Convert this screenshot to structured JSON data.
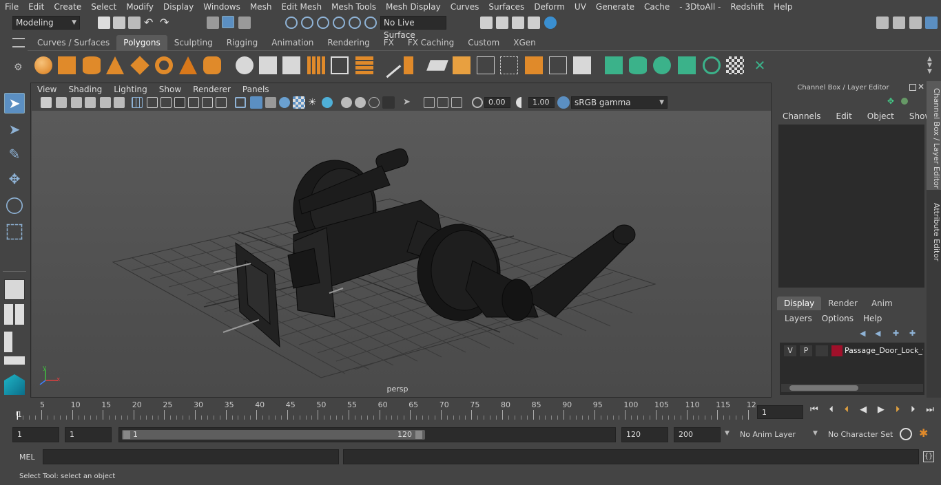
{
  "menubar": [
    "File",
    "Edit",
    "Create",
    "Select",
    "Modify",
    "Display",
    "Windows",
    "Mesh",
    "Edit Mesh",
    "Mesh Tools",
    "Mesh Display",
    "Curves",
    "Surfaces",
    "Deform",
    "UV",
    "Generate",
    "Cache",
    "- 3DtoAll -",
    "Redshift",
    "Help"
  ],
  "statusline": {
    "mode": "Modeling",
    "live_surface": "No Live Surface"
  },
  "shelf_tabs": [
    "Curves / Surfaces",
    "Polygons",
    "Sculpting",
    "Rigging",
    "Animation",
    "Rendering",
    "FX",
    "FX Caching",
    "Custom",
    "XGen"
  ],
  "shelf_active": "Polygons",
  "viewport": {
    "menu": [
      "View",
      "Shading",
      "Lighting",
      "Show",
      "Renderer",
      "Panels"
    ],
    "exposure": "0.00",
    "gamma": "1.00",
    "color_space": "sRGB gamma",
    "camera_label": "persp"
  },
  "channel_box": {
    "title": "Channel Box / Layer Editor",
    "menu": [
      "Channels",
      "Edit",
      "Object",
      "Show"
    ],
    "layer_tabs": [
      "Display",
      "Render",
      "Anim"
    ],
    "layer_menu": [
      "Layers",
      "Options",
      "Help"
    ],
    "layer": {
      "v": "V",
      "p": "P",
      "name": "Passage_Door_Lock_w",
      "color": "#a0102a"
    }
  },
  "side_tabs": [
    "Channel Box / Layer Editor",
    "Attribute Editor"
  ],
  "timeline": {
    "ticks": [
      "5",
      "10",
      "15",
      "20",
      "25",
      "30",
      "35",
      "40",
      "45",
      "50",
      "55",
      "60",
      "65",
      "70",
      "75",
      "80",
      "85",
      "90",
      "95",
      "100",
      "105",
      "110",
      "115",
      "12"
    ],
    "start_label": "1",
    "current_frame": "1"
  },
  "range": {
    "start": "1",
    "playback_start": "1",
    "slider_start": "1",
    "slider_end": "120",
    "playback_end": "120",
    "end": "200",
    "anim_layer": "No Anim Layer",
    "character_set": "No Character Set"
  },
  "cmdline": {
    "label": "MEL"
  },
  "helpline": {
    "text": "Select Tool: select an object"
  }
}
